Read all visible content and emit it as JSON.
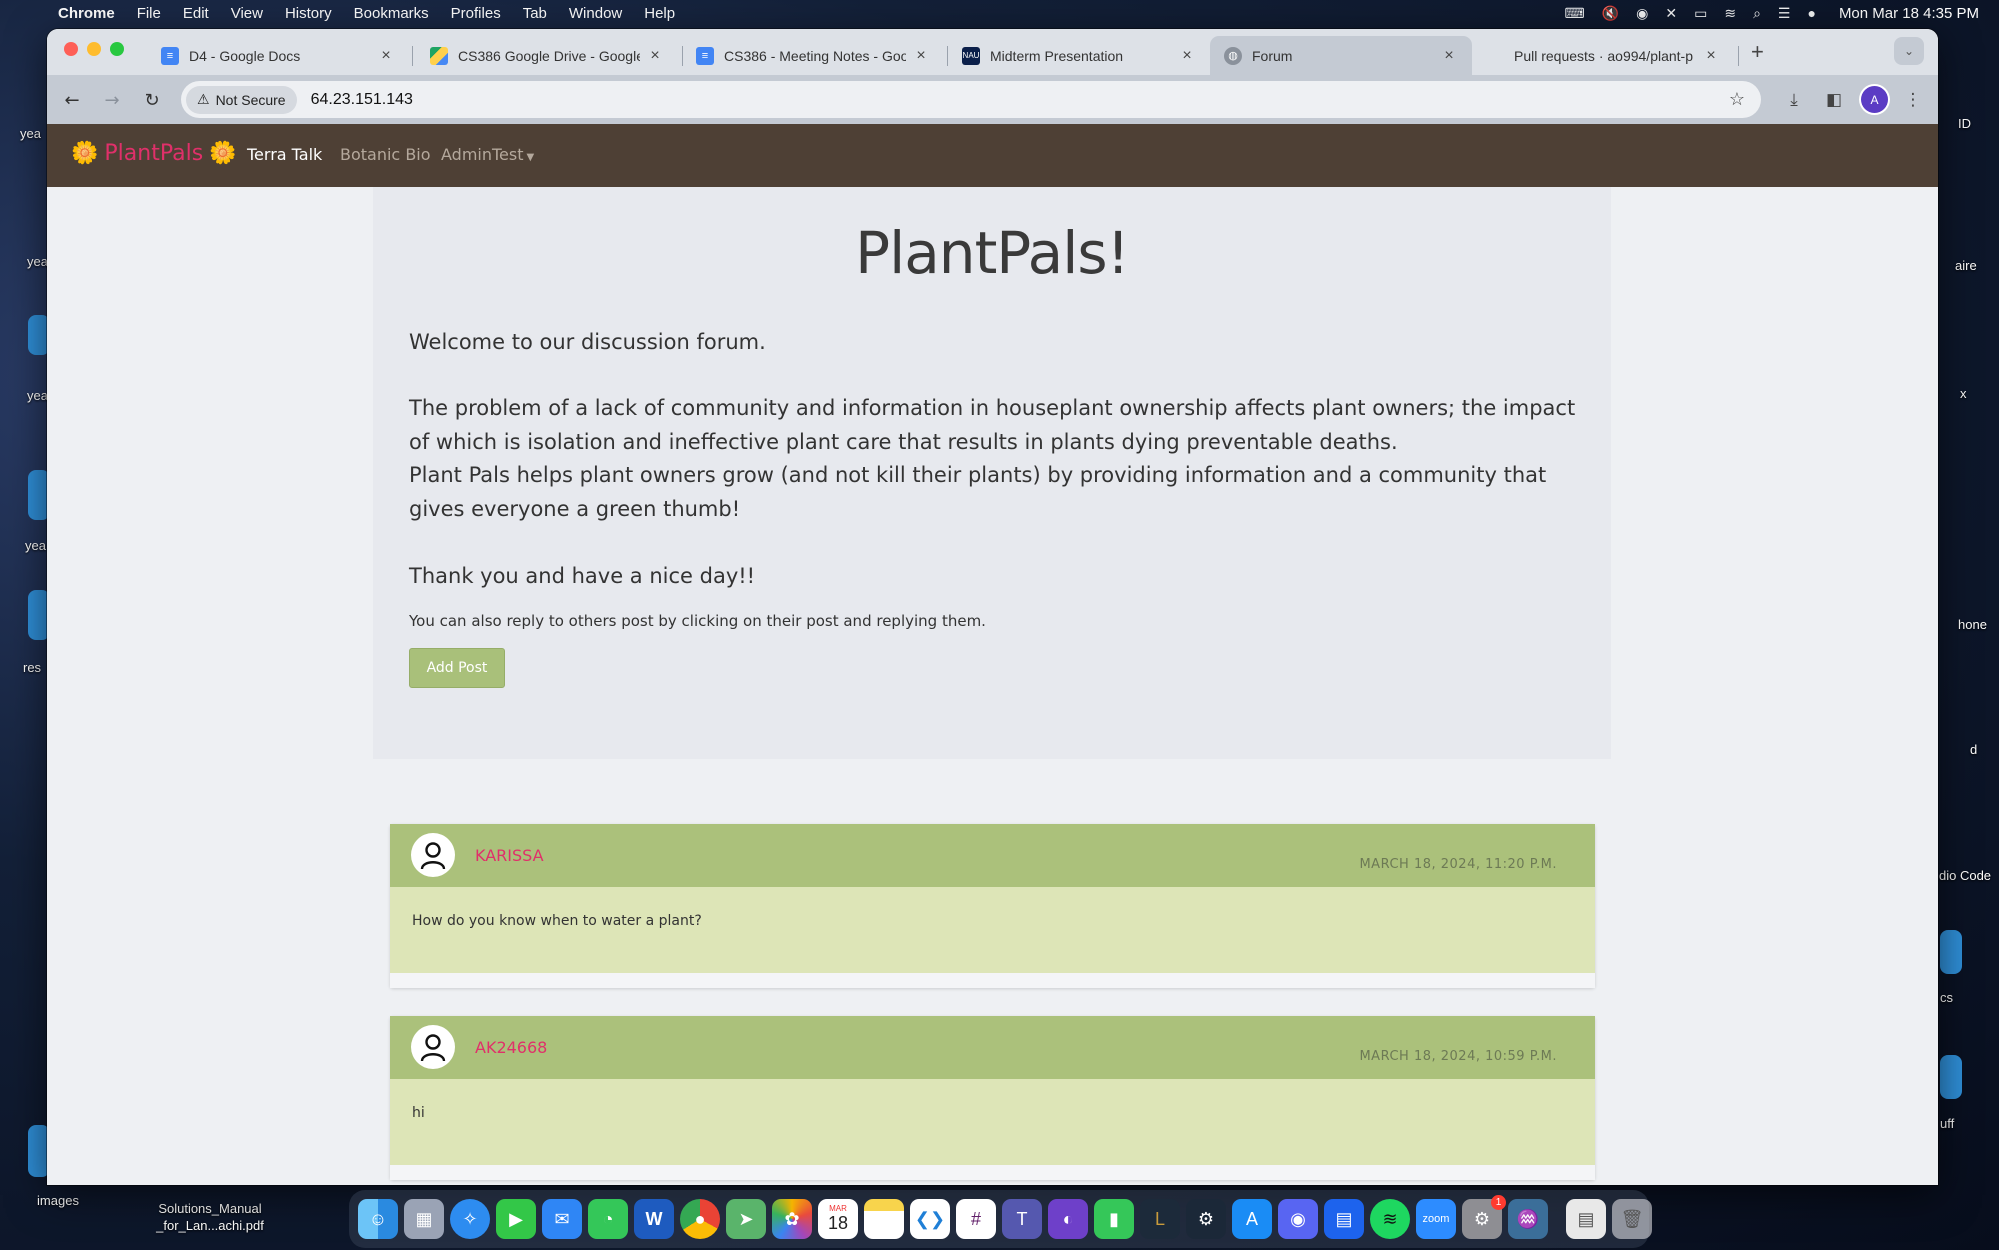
{
  "menubar": {
    "items": [
      "Chrome",
      "File",
      "Edit",
      "View",
      "History",
      "Bookmarks",
      "Profiles",
      "Tab",
      "Window",
      "Help"
    ],
    "clock": "Mon Mar 18  4:35 PM"
  },
  "desktop": {
    "left_labels": [
      "yea",
      "yea",
      "yea",
      "yea",
      "res"
    ],
    "right_labels": [
      "ID",
      "aire",
      "x",
      "hone",
      "d",
      "dio Code",
      "cs",
      "uff"
    ],
    "files": [
      {
        "label": "images"
      },
      {
        "label_line1": "Solutions_Manual",
        "label_line2": "_for_Lan...achi.pdf"
      }
    ]
  },
  "browser": {
    "tabs": [
      {
        "title": "D4 - Google Docs",
        "icon": "google-docs-icon",
        "active": false
      },
      {
        "title": "CS386 Google Drive - Google",
        "icon": "google-drive-icon",
        "active": false
      },
      {
        "title": "CS386 - Meeting Notes - Goo",
        "icon": "google-docs-icon",
        "active": false
      },
      {
        "title": "Midterm Presentation",
        "icon": "nau-icon",
        "active": false
      },
      {
        "title": "Forum",
        "icon": "globe-icon",
        "active": true
      },
      {
        "title": "Pull requests · ao994/plant-p",
        "icon": "github-icon",
        "active": false
      }
    ],
    "security_label": "Not Secure",
    "url": "64.23.151.143",
    "profile_initial": "A"
  },
  "site": {
    "brand": "PlantPals",
    "brand_flower": "🌼",
    "nav": [
      {
        "label": "Terra Talk",
        "active": true
      },
      {
        "label": "Botanic Bio",
        "active": false
      },
      {
        "label": "AdminTest",
        "active": false,
        "dropdown": true
      }
    ],
    "hero": {
      "title": "PlantPals!",
      "welcome": "Welcome to our discussion forum.",
      "problem": "The problem of a lack of community and information in houseplant ownership affects plant owners; the impact of which is isolation and ineffective plant care that results in plants dying preventable deaths.",
      "mission": "Plant Pals helps plant owners grow (and not kill their plants) by providing information and a community that gives everyone a green thumb!",
      "thanks": "Thank you and have a nice day!!",
      "note": "You can also reply to others post by clicking on their post and replying them.",
      "add_post_label": "Add Post"
    },
    "posts": [
      {
        "user": "KARISSA",
        "date": "MARCH 18, 2024, 11:20 P.M.",
        "text": "How do you know when to water a plant?"
      },
      {
        "user": "AK24668",
        "date": "MARCH 18, 2024, 10:59 P.M.",
        "text": "hi"
      }
    ]
  },
  "dock": {
    "apps": [
      "finder",
      "launchpad",
      "safari",
      "facetime",
      "mail",
      "messages",
      "word",
      "chrome",
      "maps",
      "photos",
      "calendar",
      "notes",
      "vscode",
      "slack",
      "teams",
      "github-desktop",
      "numbers",
      "league-of-legends",
      "steam",
      "app-store",
      "discord",
      "docker",
      "spotify",
      "zoom",
      "system-settings",
      "mysql-workbench"
    ],
    "calendar_month": "MAR",
    "calendar_day": "18",
    "settings_badge": "1",
    "word_letter": "W",
    "zoom_label": "zoom"
  },
  "colors": {
    "navbar": "#4e4035",
    "brand": "#e0306a",
    "post_header": "#abc17b",
    "post_body": "#dde5b7",
    "button": "#a9c07a"
  }
}
